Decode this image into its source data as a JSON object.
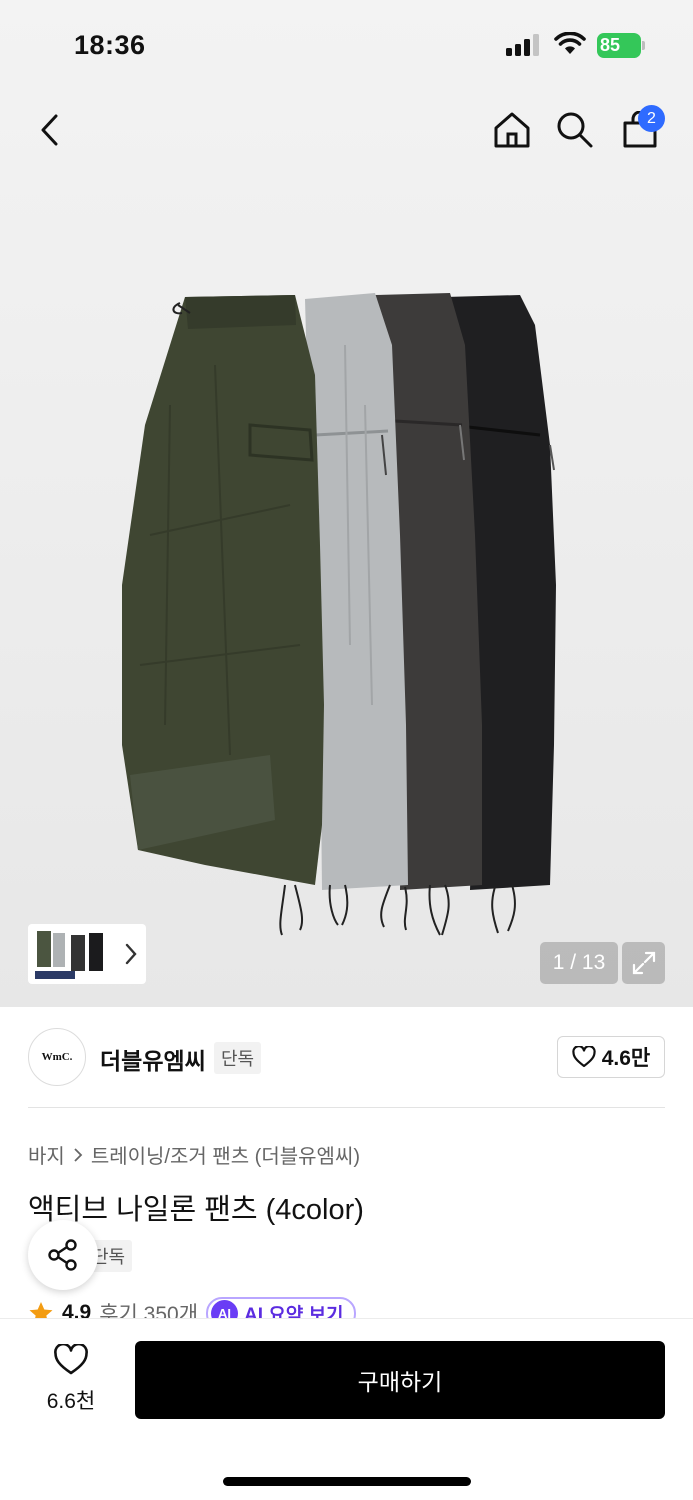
{
  "status_bar": {
    "time": "18:36",
    "battery": "85"
  },
  "header": {
    "cart_count": "2"
  },
  "gallery": {
    "page_indicator": "1 / 13"
  },
  "brand": {
    "logo_text": "WmC.",
    "name": "더블유엠씨",
    "tag": "단독",
    "likes": "4.6만"
  },
  "breadcrumb": {
    "category": "바지",
    "subcategory": "트레이닝/조거 팬츠 (더블유엠씨)"
  },
  "product": {
    "title": "액티브 나일론 팬츠 (4color)",
    "tag": "단독"
  },
  "rating": {
    "score": "4.9",
    "reviews": "후기 350개",
    "ai_badge": "AI",
    "ai_label": "AI 요약 보기"
  },
  "bottom": {
    "wish_count": "6.6천",
    "buy_label": "구매하기"
  },
  "colors": {
    "badge_blue": "#2f6bff",
    "battery_green": "#34c759",
    "ai_purple": "#6a3df5",
    "star": "#f39c12"
  },
  "icons": [
    "back-icon",
    "home-icon",
    "search-icon",
    "cart-icon",
    "chevron-right-icon",
    "expand-icon",
    "heart-icon",
    "share-icon",
    "star-icon"
  ]
}
